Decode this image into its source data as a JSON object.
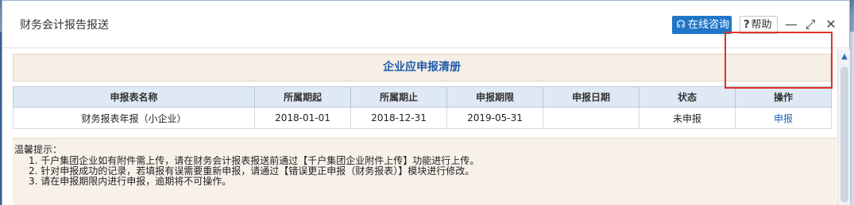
{
  "dialog": {
    "title": "财务会计报告报送",
    "consult_label": "在线咨询",
    "help_label": "帮助",
    "help_icon": "?",
    "minimize_glyph": "—",
    "maximize_glyph": "⤢",
    "close_glyph": "✕"
  },
  "panel": {
    "title": "企业应申报清册"
  },
  "table": {
    "headers": [
      "申报表名称",
      "所属期起",
      "所属期止",
      "申报期限",
      "申报日期",
      "状态",
      "操作"
    ],
    "rows": [
      {
        "name": "财务报表年报（小企业）",
        "period_start": "2018-01-01",
        "period_end": "2018-12-31",
        "deadline": "2019-05-31",
        "declare_date": "",
        "status": "未申报",
        "action": "申报"
      }
    ]
  },
  "tips": {
    "title": "温馨提示：",
    "lines": [
      "1. 千户集团企业如有附件需上传，请在财务会计报表报送前通过【千户集团企业附件上传】功能进行上传。",
      "2. 针对申报成功的记录，若填报有误需要重新申报，请通过【错误更正申报（财务报表）】模块进行修改。",
      "3. 请在申报期限内进行申报，逾期将不可操作。"
    ]
  },
  "colors": {
    "accent": "#1f76c8",
    "header_bg": "#dfe9f5",
    "highlight": "#e0302a",
    "panel_bg": "#f6efe6"
  }
}
